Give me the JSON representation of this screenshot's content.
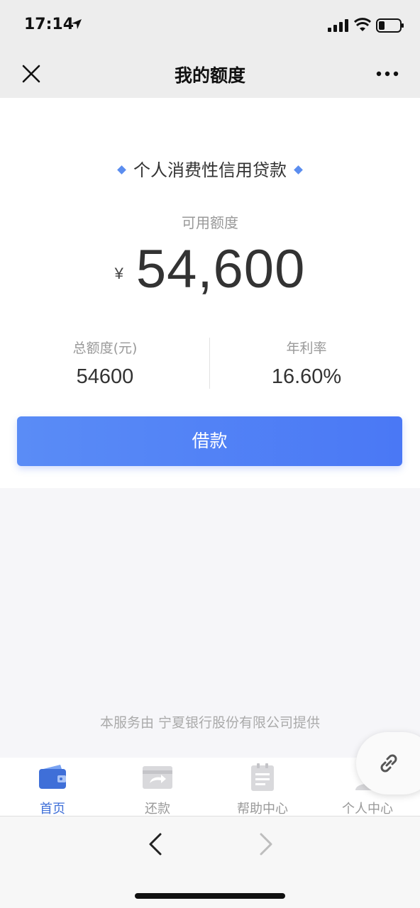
{
  "status_bar": {
    "time": "17:14"
  },
  "nav": {
    "title": "我的额度"
  },
  "card": {
    "product_name": "个人消费性信用贷款",
    "available_label": "可用额度",
    "currency_symbol": "¥",
    "available_amount": "54,600",
    "total_label": "总额度(元)",
    "total_value": "54600",
    "rate_label": "年利率",
    "rate_value": "16.60%",
    "borrow_label": "借款"
  },
  "footer": {
    "provider_text": "本服务由 宁夏银行股份有限公司提供"
  },
  "tabs": [
    {
      "label": "首页",
      "icon": "wallet-icon",
      "active": true
    },
    {
      "label": "还款",
      "icon": "repay-card-icon",
      "active": false
    },
    {
      "label": "帮助中心",
      "icon": "clipboard-icon",
      "active": false
    },
    {
      "label": "个人中心",
      "icon": "user-icon",
      "active": false
    }
  ],
  "colors": {
    "accent": "#4a78f5",
    "active_tab": "#3f6fd8",
    "nav_bg": "#ededed"
  }
}
